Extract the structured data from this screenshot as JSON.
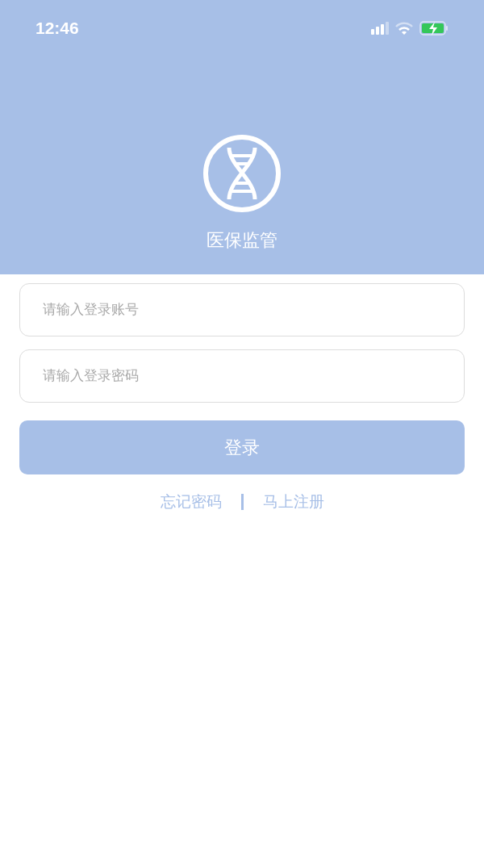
{
  "status_bar": {
    "time": "12:46"
  },
  "header": {
    "title": "医保监管"
  },
  "fields": [
    {
      "placeholder": "请输入登录账号"
    },
    {
      "placeholder": "请输入登录密码"
    }
  ],
  "login_button": {
    "label": "登录"
  },
  "links": [
    {
      "label": "忘记密码"
    },
    {
      "label": "马上注册"
    }
  ]
}
